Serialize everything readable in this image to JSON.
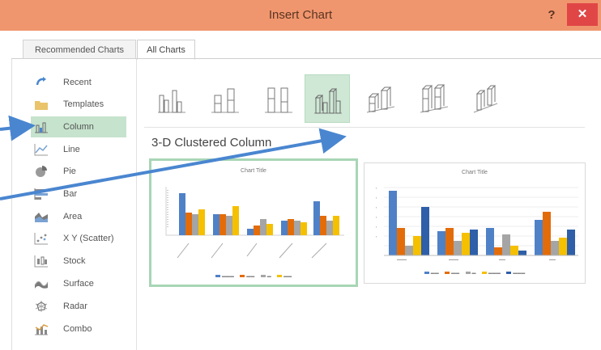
{
  "window": {
    "title": "Insert Chart",
    "help_label": "?",
    "close_label": "✕"
  },
  "tabs": [
    {
      "label": "Recommended Charts",
      "selected": false
    },
    {
      "label": "All Charts",
      "selected": true
    }
  ],
  "sidebar": {
    "items": [
      {
        "label": "Recent",
        "icon": "recent-icon"
      },
      {
        "label": "Templates",
        "icon": "templates-folder-icon"
      },
      {
        "label": "Column",
        "icon": "column-chart-icon",
        "selected": true
      },
      {
        "label": "Line",
        "icon": "line-chart-icon"
      },
      {
        "label": "Pie",
        "icon": "pie-chart-icon"
      },
      {
        "label": "Bar",
        "icon": "bar-chart-icon"
      },
      {
        "label": "Area",
        "icon": "area-chart-icon"
      },
      {
        "label": "X Y (Scatter)",
        "icon": "scatter-chart-icon"
      },
      {
        "label": "Stock",
        "icon": "stock-chart-icon"
      },
      {
        "label": "Surface",
        "icon": "surface-chart-icon"
      },
      {
        "label": "Radar",
        "icon": "radar-chart-icon"
      },
      {
        "label": "Combo",
        "icon": "combo-chart-icon"
      }
    ]
  },
  "subtypes": {
    "selected_index": 3,
    "count": 7
  },
  "section_title": "3-D Clustered Column",
  "previews": [
    {
      "title": "Chart Title",
      "selected": true
    },
    {
      "title": "Chart Title",
      "selected": false
    }
  ],
  "colors": {
    "title_bar": "#f0966e",
    "close_button": "#e04646",
    "selection_green": "#c6e3cd",
    "arrow_blue": "#4a86d0",
    "series": [
      "#4f81c7",
      "#e36c0a",
      "#a5a5a5",
      "#f5c000",
      "#2e5fa8"
    ]
  }
}
